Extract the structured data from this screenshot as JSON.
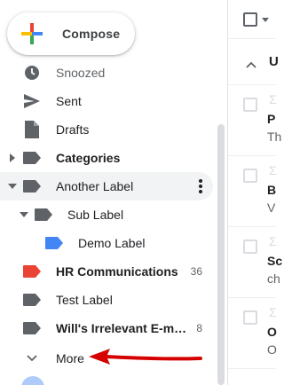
{
  "compose": {
    "label": "Compose"
  },
  "nav": {
    "snoozed": "Snoozed",
    "sent": "Sent",
    "drafts": "Drafts",
    "categories": "Categories",
    "another_label": "Another Label",
    "sub_label": "Sub Label",
    "demo_label": "Demo Label",
    "hr": {
      "label": "HR Communications",
      "count": "36"
    },
    "test_label": "Test Label",
    "irrelevant": {
      "label": "Will's Irrelevant E-m…",
      "count": "8"
    },
    "more": "More"
  },
  "colors": {
    "hr_label": "#ea4335",
    "demo_label": "#4285f4",
    "default_label": "#5f6368",
    "annotation_arrow": "#d50000"
  },
  "main": {
    "section_initial": "U",
    "rows": [
      {
        "line1": "P",
        "line2": "Th"
      },
      {
        "line1": "B",
        "line2": "V"
      },
      {
        "line1": "Sc",
        "line2": "ch"
      },
      {
        "line1": "O",
        "line2": "O"
      }
    ]
  },
  "icons": {
    "compose": "plus-multicolor-icon",
    "snoozed": "clock-icon",
    "sent": "send-icon",
    "drafts": "draft-icon",
    "label": "label-tag-icon",
    "more": "chevron-down-icon"
  }
}
